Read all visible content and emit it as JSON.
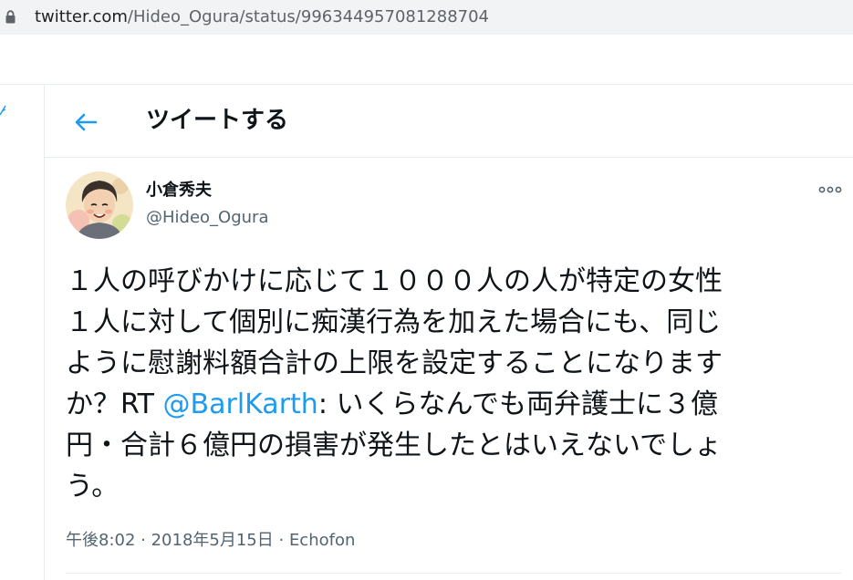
{
  "browser": {
    "url_host": "twitter.com",
    "url_path": "/Hideo_Ogura/status/996344957081288704"
  },
  "header": {
    "title": "ツイートする",
    "back_icon": "arrow-left-icon"
  },
  "tweet": {
    "author": {
      "display_name": "小倉秀夫",
      "handle": "@Hideo_Ogura"
    },
    "text_lines": [
      "１人の呼びかけに応じて１０００人の人が特定の女性",
      "１人に対して個別に痴漢行為を加えた場合にも、同じ",
      "ように慰謝料額合計の上限を設定することになります",
      "か？RT ",
      "@BarlKarth",
      ": いくらなんでも両弁護士に３億",
      "円・合計６億円の損害が発生したとはいえないでしょ",
      "う。"
    ],
    "meta": {
      "time": "午後8:02",
      "sep1": " · ",
      "date": "2018年5月15日",
      "sep2": " · ",
      "source": "Echofon"
    }
  },
  "colors": {
    "accent": "#1d9bf0",
    "text": "#0f1419",
    "secondary": "#536471",
    "border": "#e6ecf0"
  }
}
